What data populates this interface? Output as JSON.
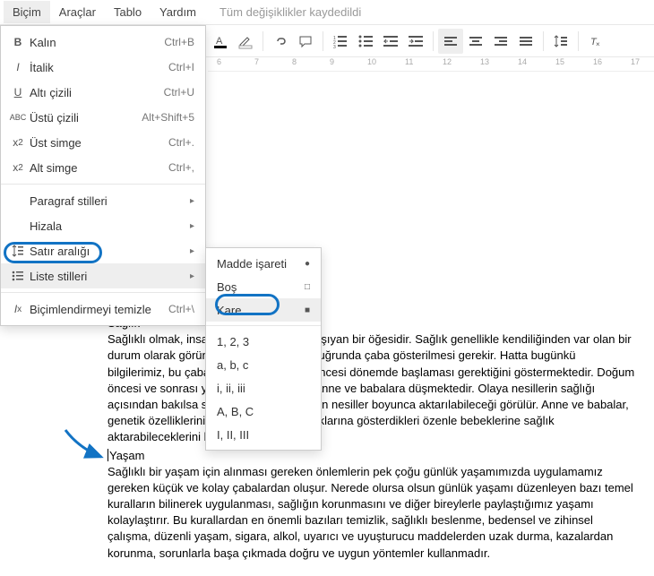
{
  "menubar": {
    "items": [
      "Biçim",
      "Araçlar",
      "Tablo",
      "Yardım"
    ],
    "save_status": "Tüm değişiklikler kaydedildi"
  },
  "ruler_marks": [
    "6",
    "7",
    "8",
    "9",
    "10",
    "11",
    "12",
    "13",
    "14",
    "15",
    "16",
    "17"
  ],
  "format_menu": {
    "bold": {
      "label": "Kalın",
      "shortcut": "Ctrl+B"
    },
    "italic": {
      "label": "İtalik",
      "shortcut": "Ctrl+I"
    },
    "underline": {
      "label": "Altı çizili",
      "shortcut": "Ctrl+U"
    },
    "strike": {
      "label": "Üstü çizili",
      "shortcut": "Alt+Shift+5"
    },
    "superscript": {
      "label": "Üst simge",
      "shortcut": "Ctrl+."
    },
    "subscript": {
      "label": "Alt simge",
      "shortcut": "Ctrl+,"
    },
    "para_styles": {
      "label": "Paragraf stilleri"
    },
    "align": {
      "label": "Hizala"
    },
    "line_space": {
      "label": "Satır aralığı"
    },
    "list_styles": {
      "label": "Liste stilleri"
    },
    "clear": {
      "label": "Biçimlendirmeyi temizle",
      "shortcut": "Ctrl+\\"
    }
  },
  "list_submenu": {
    "bullet": {
      "label": "Madde işareti",
      "glyph": "●"
    },
    "empty": {
      "label": "Boş",
      "glyph": "□"
    },
    "square": {
      "label": "Kare",
      "glyph": "■"
    },
    "n123": {
      "label": "1, 2, 3"
    },
    "abc": {
      "label": "a, b, c"
    },
    "roman_l": {
      "label": "i, ii, iii"
    },
    "ABC": {
      "label": "A, B, C"
    },
    "roman_u": {
      "label": "I, II, III"
    }
  },
  "doc": {
    "h1": "Sağlık",
    "p1": "Sağlıklı olmak, insan yaşamı için önem taşıyan bir öğesidir. Sağlık genellikle kendiliğinden var olan bir durum olarak görünürse de sağlıklı olma uğrunda çaba gösterilmesi gerekir. Hatta bugünkü bilgilerimiz, bu çabanın anne ve doğum öncesi dönemde başlaması gerektiğini göstermektedir. Doğum öncesi ve sonrası yapılması gerekenler, anne ve babalara düşmektedir. Olaya nesillerin sağlığı açısından bakılsa sağlığın ve sağlıksızlığın nesiller boyunca aktarılabileceği görülür. Anne ve babalar, genetik özelliklerinin yanı sıra kendi sağlıklarına gösterdikleri özenle bebeklerine sağlık aktarabileceklerini bilmelidirler.",
    "h2": "Yaşam",
    "p2": "Sağlıklı bir yaşam için alınması gereken önlemlerin pek çoğu günlük yaşamımızda  uygulamamız gereken küçük ve kolay çabalardan oluşur. Nerede olursa olsun günlük yaşamı düzenleyen bazı temel kuralların bilinerek uygulanması, sağlığın korunmasını ve diğer bireylerle paylaştığımız yaşamı kolaylaştırır. Bu kurallardan en önemli bazıları temizlik, sağlıklı beslenme, bedensel ve zihinsel çalışma, düzenli yaşam, sigara, alkol, uyarıcı ve uyuşturucu maddelerden uzak durma, kazalardan korunma, sorunlarla başa çıkmada doğru ve uygun yöntemler kullanmadır."
  }
}
